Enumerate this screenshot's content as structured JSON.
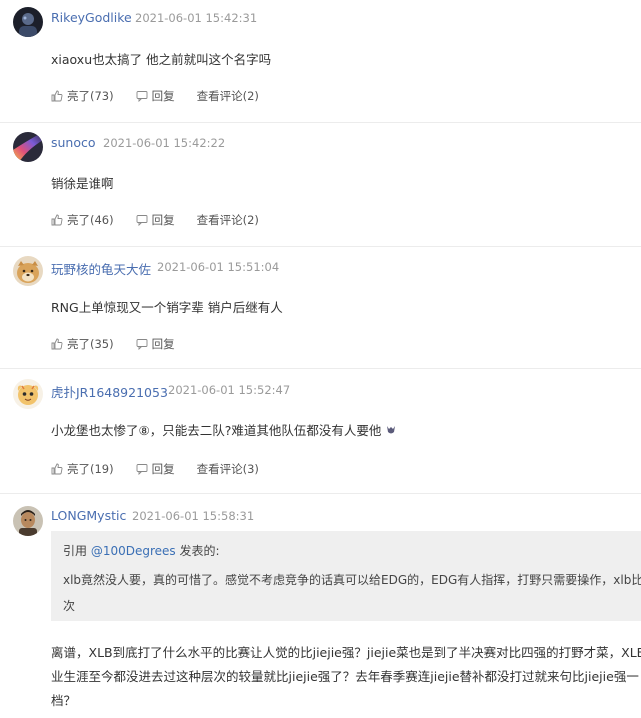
{
  "comments": [
    {
      "username": "RikeyGodlike",
      "time": "2021-06-01 15:42:31",
      "text": "xiaoxu也太搞了 他之前就叫这个名字吗",
      "likes": "亮了(73)",
      "reply": "回复",
      "view": "查看评论(2)"
    },
    {
      "username": "sunoco",
      "time": "2021-06-01 15:42:22",
      "text": "销徐是谁啊",
      "likes": "亮了(46)",
      "reply": "回复",
      "view": "查看评论(2)"
    },
    {
      "username": "玩野核的龟天大佐",
      "time": "2021-06-01 15:51:04",
      "text": "RNG上单惊现又一个销字辈 销户后继有人",
      "likes": "亮了(35)",
      "reply": "回复"
    },
    {
      "username": "虎扑JR1648921053",
      "time": "2021-06-01 15:52:47",
      "text": "小龙堡也太惨了⑧，只能去二队?难道其他队伍都没有人要他",
      "likes": "亮了(19)",
      "reply": "回复",
      "view": "查看评论(3)"
    },
    {
      "username": "LONGMystic",
      "time": "2021-06-01 15:58:31",
      "quote": {
        "prefix": "引用 ",
        "mention": "@100Degrees",
        "suffix": " 发表的:",
        "line1": "xlb竟然没人要，真的可惜了。感觉不考虑竞争的话真可以给EDG的，EDG有人指挥，打野只需要操作，xlb比jie",
        "line2": "次"
      },
      "text_lines": [
        "离谱，XLB到底打了什么水平的比赛让人觉的比jiejie强？jiejie菜也是到了半决赛对比四强的打野才菜，XLB职",
        "业生涯至今都没进去过这种层次的较量就比jiejie强了？去年春季赛连jiejie替补都没打过就来句比jiejie强一",
        "档？"
      ]
    }
  ]
}
